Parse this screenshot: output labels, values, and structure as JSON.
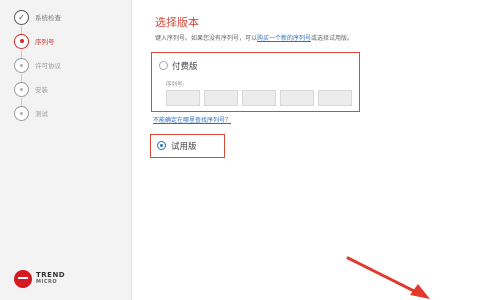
{
  "sidebar": {
    "steps": [
      {
        "label": "系统检查",
        "state": "done"
      },
      {
        "label": "序列号",
        "state": "current"
      },
      {
        "label": "许可协议",
        "state": "pending"
      },
      {
        "label": "安装",
        "state": "pending"
      },
      {
        "label": "测试",
        "state": "pending"
      }
    ],
    "logo": {
      "line1": "TREND",
      "line2": "MICRO"
    }
  },
  "main": {
    "title": "选择版本",
    "description_prefix": "键入序列号。如果您没有序列号，可以",
    "description_link": "购买一个新的序列号",
    "description_suffix": "或选择试用版。",
    "paid_option": {
      "label": "付费版",
      "selected": false
    },
    "serial_label": "序列号:",
    "serial_segments": [
      "",
      "",
      "",
      "",
      ""
    ],
    "help_link": "不能确定在哪里查找序列号？",
    "trial_option": {
      "label": "试用版",
      "selected": true
    }
  },
  "colors": {
    "accent": "#d84a3a",
    "link": "#2f6fbf",
    "brand": "#d71920"
  }
}
